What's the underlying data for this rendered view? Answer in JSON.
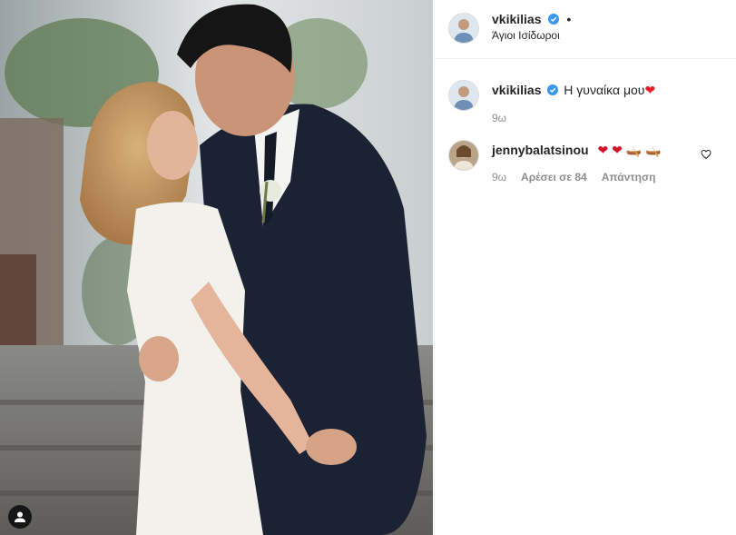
{
  "post": {
    "username": "vkikilias",
    "location": "Άγιοι Ισίδωροι",
    "dot": "•"
  },
  "comments": [
    {
      "username": "vkikilias",
      "text": "Η γυναίκα μου",
      "emoji": "❤",
      "time": "9ω"
    },
    {
      "username": "jennybalatsinou",
      "emoji": "❤ ❤ 🛶 🛶",
      "time": "9ω",
      "likes": "Αρέσει σε 84",
      "reply": "Απάντηση"
    }
  ],
  "icons": {
    "verified": "verified-badge-icon",
    "tag": "user-tag-icon",
    "like": "heart-outline-icon"
  },
  "colors": {
    "verified": "#3897f0",
    "heart": "#ed4956",
    "muted": "#8e8e8e"
  }
}
